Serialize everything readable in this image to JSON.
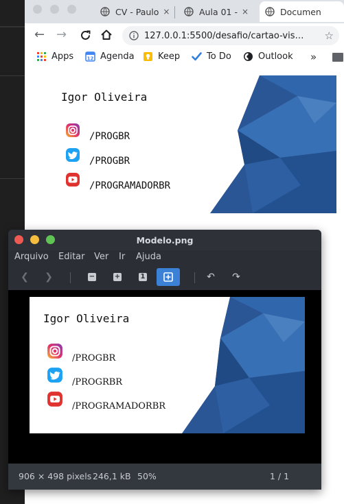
{
  "browser": {
    "tabs": [
      {
        "label": "CV - Paulo",
        "close": "×"
      },
      {
        "label": "Aula 01 - ",
        "close": "×"
      },
      {
        "label": "Documen",
        "close": ""
      }
    ],
    "url": "127.0.0.1:5500/desafio/cartao-vis…",
    "bookmarks": [
      {
        "label": "Apps",
        "icon": "apps-grid-icon"
      },
      {
        "label": "Agenda",
        "icon": "calendar-icon"
      },
      {
        "label": "Keep",
        "icon": "keep-bulb-icon"
      },
      {
        "label": "To Do",
        "icon": "todo-check-icon"
      },
      {
        "label": "Outlook",
        "icon": "outlook-icon"
      }
    ],
    "more": "»"
  },
  "card": {
    "name": "Igor Oliveira",
    "instagram": "/PROGBR",
    "twitter": "/PROGBR",
    "youtube": "/PROGRAMADORBR"
  },
  "preview_card": {
    "name": "Igor Oliveira",
    "instagram": "/PROGBR",
    "twitter": "/PROGRBR",
    "youtube": "/PROGRAMADORBR"
  },
  "viewer": {
    "title": "Modelo.png",
    "menu": [
      "Arquivo",
      "Editar",
      "Ver",
      "Ir",
      "Ajuda"
    ],
    "status": {
      "dimensions": "906 × 498 pixels",
      "size": "246,1 kB",
      "zoom": "50%",
      "page": "1 / 1"
    }
  },
  "colors": {
    "card_blue": "#2b5a9a",
    "viewer_accent": "#3b82d6",
    "close_red": "#ee5a52",
    "min_yellow": "#f5be3f",
    "max_green": "#5fc453"
  }
}
